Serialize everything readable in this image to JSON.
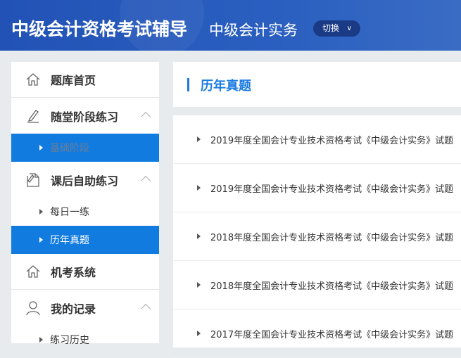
{
  "header": {
    "title": "中级会计资格考试辅导",
    "subject": "中级会计实务",
    "switch_label": "切换"
  },
  "sidebar": {
    "items": [
      {
        "label": "题库首页",
        "icon": "home-icon"
      },
      {
        "label": "随堂阶段练习",
        "icon": "edit-icon",
        "subitems": [
          "基础阶段"
        ]
      },
      {
        "label": "课后自助练习",
        "icon": "document-edit-icon",
        "subitems": [
          "每日一练",
          "历年真题"
        ]
      },
      {
        "label": "机考系统",
        "icon": "home-icon"
      },
      {
        "label": "我的记录",
        "icon": "user-icon",
        "subitems": [
          "练习历史"
        ]
      }
    ]
  },
  "main": {
    "title": "历年真题",
    "papers": [
      "2019年度全国会计专业技术资格考试《中级会计实务》试题",
      "2019年度全国会计专业技术资格考试《中级会计实务》试题",
      "2018年度全国会计专业技术资格考试《中级会计实务》试题",
      "2018年度全国会计专业技术资格考试《中级会计实务》试题",
      "2017年度全国会计专业技术资格考试《中级会计实务》试题"
    ]
  },
  "colors": {
    "accent": "#127be0",
    "header": "#2252b5"
  }
}
